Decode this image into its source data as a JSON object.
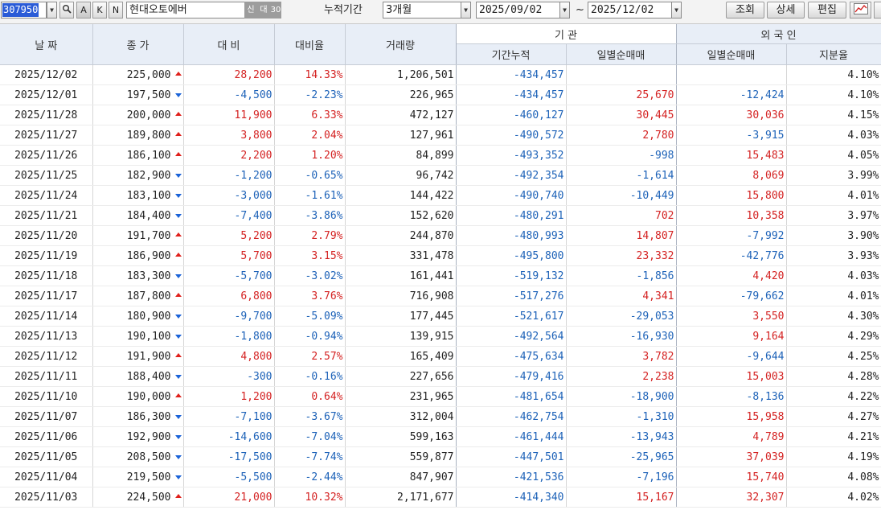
{
  "toolbar": {
    "stock_code": "307950",
    "stock_name": "현대오토에버",
    "btn_search_icon": "magnifier-icon",
    "btn_a": "A",
    "btn_k": "K",
    "btn_n": "N",
    "badge_new": "신",
    "badge_loan": "대",
    "badge_30": "30",
    "period_label": "누적기간",
    "period_value": "3개월",
    "date_from": "2025/09/02",
    "tilde": "~",
    "date_to": "2025/12/02",
    "btn_query": "조회",
    "btn_detail": "상세",
    "btn_edit": "편집",
    "chart_icon": "line-chart-icon",
    "dropdown_glyph": "▼"
  },
  "headers": {
    "date": "날 짜",
    "close": "종 가",
    "change": "대 비",
    "change_rate": "대비율",
    "volume": "거래량",
    "institution": "기 관",
    "inst_cumulative": "기간누적",
    "inst_daily_net": "일별순매매",
    "foreign": "외 국 인",
    "foreign_daily_net": "일별순매매",
    "foreign_share": "지분율"
  },
  "colors": {
    "up": "#d42222",
    "down": "#1d62b8",
    "header_bg": "#e8eef7"
  },
  "rows": [
    {
      "date": "2025/12/02",
      "close": "225,000",
      "dir": "up",
      "change": "28,200",
      "rate": "14.33%",
      "volume": "1,206,501",
      "inst_cum": "-434,457",
      "inst_daily": "",
      "frgn_daily": "",
      "share": "4.10%"
    },
    {
      "date": "2025/12/01",
      "close": "197,500",
      "dir": "down",
      "change": "-4,500",
      "rate": "-2.23%",
      "volume": "226,965",
      "inst_cum": "-434,457",
      "inst_daily": "25,670",
      "frgn_daily": "-12,424",
      "share": "4.10%"
    },
    {
      "date": "2025/11/28",
      "close": "200,000",
      "dir": "up",
      "change": "11,900",
      "rate": "6.33%",
      "volume": "472,127",
      "inst_cum": "-460,127",
      "inst_daily": "30,445",
      "frgn_daily": "30,036",
      "share": "4.15%"
    },
    {
      "date": "2025/11/27",
      "close": "189,800",
      "dir": "up",
      "change": "3,800",
      "rate": "2.04%",
      "volume": "127,961",
      "inst_cum": "-490,572",
      "inst_daily": "2,780",
      "frgn_daily": "-3,915",
      "share": "4.03%"
    },
    {
      "date": "2025/11/26",
      "close": "186,100",
      "dir": "up",
      "change": "2,200",
      "rate": "1.20%",
      "volume": "84,899",
      "inst_cum": "-493,352",
      "inst_daily": "-998",
      "frgn_daily": "15,483",
      "share": "4.05%"
    },
    {
      "date": "2025/11/25",
      "close": "182,900",
      "dir": "down",
      "change": "-1,200",
      "rate": "-0.65%",
      "volume": "96,742",
      "inst_cum": "-492,354",
      "inst_daily": "-1,614",
      "frgn_daily": "8,069",
      "share": "3.99%"
    },
    {
      "date": "2025/11/24",
      "close": "183,100",
      "dir": "down",
      "change": "-3,000",
      "rate": "-1.61%",
      "volume": "144,422",
      "inst_cum": "-490,740",
      "inst_daily": "-10,449",
      "frgn_daily": "15,800",
      "share": "4.01%"
    },
    {
      "date": "2025/11/21",
      "close": "184,400",
      "dir": "down",
      "change": "-7,400",
      "rate": "-3.86%",
      "volume": "152,620",
      "inst_cum": "-480,291",
      "inst_daily": "702",
      "frgn_daily": "10,358",
      "share": "3.97%"
    },
    {
      "date": "2025/11/20",
      "close": "191,700",
      "dir": "up",
      "change": "5,200",
      "rate": "2.79%",
      "volume": "244,870",
      "inst_cum": "-480,993",
      "inst_daily": "14,807",
      "frgn_daily": "-7,992",
      "share": "3.90%"
    },
    {
      "date": "2025/11/19",
      "close": "186,900",
      "dir": "up",
      "change": "5,700",
      "rate": "3.15%",
      "volume": "331,478",
      "inst_cum": "-495,800",
      "inst_daily": "23,332",
      "frgn_daily": "-42,776",
      "share": "3.93%"
    },
    {
      "date": "2025/11/18",
      "close": "183,300",
      "dir": "down",
      "change": "-5,700",
      "rate": "-3.02%",
      "volume": "161,441",
      "inst_cum": "-519,132",
      "inst_daily": "-1,856",
      "frgn_daily": "4,420",
      "share": "4.03%"
    },
    {
      "date": "2025/11/17",
      "close": "187,800",
      "dir": "up",
      "change": "6,800",
      "rate": "3.76%",
      "volume": "716,908",
      "inst_cum": "-517,276",
      "inst_daily": "4,341",
      "frgn_daily": "-79,662",
      "share": "4.01%"
    },
    {
      "date": "2025/11/14",
      "close": "180,900",
      "dir": "down",
      "change": "-9,700",
      "rate": "-5.09%",
      "volume": "177,445",
      "inst_cum": "-521,617",
      "inst_daily": "-29,053",
      "frgn_daily": "3,550",
      "share": "4.30%"
    },
    {
      "date": "2025/11/13",
      "close": "190,100",
      "dir": "down",
      "change": "-1,800",
      "rate": "-0.94%",
      "volume": "139,915",
      "inst_cum": "-492,564",
      "inst_daily": "-16,930",
      "frgn_daily": "9,164",
      "share": "4.29%"
    },
    {
      "date": "2025/11/12",
      "close": "191,900",
      "dir": "up",
      "change": "4,800",
      "rate": "2.57%",
      "volume": "165,409",
      "inst_cum": "-475,634",
      "inst_daily": "3,782",
      "frgn_daily": "-9,644",
      "share": "4.25%"
    },
    {
      "date": "2025/11/11",
      "close": "188,400",
      "dir": "down",
      "change": "-300",
      "rate": "-0.16%",
      "volume": "227,656",
      "inst_cum": "-479,416",
      "inst_daily": "2,238",
      "frgn_daily": "15,003",
      "share": "4.28%"
    },
    {
      "date": "2025/11/10",
      "close": "190,000",
      "dir": "up",
      "change": "1,200",
      "rate": "0.64%",
      "volume": "231,965",
      "inst_cum": "-481,654",
      "inst_daily": "-18,900",
      "frgn_daily": "-8,136",
      "share": "4.22%"
    },
    {
      "date": "2025/11/07",
      "close": "186,300",
      "dir": "down",
      "change": "-7,100",
      "rate": "-3.67%",
      "volume": "312,004",
      "inst_cum": "-462,754",
      "inst_daily": "-1,310",
      "frgn_daily": "15,958",
      "share": "4.27%"
    },
    {
      "date": "2025/11/06",
      "close": "192,900",
      "dir": "down",
      "change": "-14,600",
      "rate": "-7.04%",
      "volume": "599,163",
      "inst_cum": "-461,444",
      "inst_daily": "-13,943",
      "frgn_daily": "4,789",
      "share": "4.21%"
    },
    {
      "date": "2025/11/05",
      "close": "208,500",
      "dir": "down",
      "change": "-17,500",
      "rate": "-7.74%",
      "volume": "559,877",
      "inst_cum": "-447,501",
      "inst_daily": "-25,965",
      "frgn_daily": "37,039",
      "share": "4.19%"
    },
    {
      "date": "2025/11/04",
      "close": "219,500",
      "dir": "down",
      "change": "-5,500",
      "rate": "-2.44%",
      "volume": "847,907",
      "inst_cum": "-421,536",
      "inst_daily": "-7,196",
      "frgn_daily": "15,740",
      "share": "4.08%"
    },
    {
      "date": "2025/11/03",
      "close": "224,500",
      "dir": "up",
      "change": "21,000",
      "rate": "10.32%",
      "volume": "2,171,677",
      "inst_cum": "-414,340",
      "inst_daily": "15,167",
      "frgn_daily": "32,307",
      "share": "4.02%"
    }
  ]
}
